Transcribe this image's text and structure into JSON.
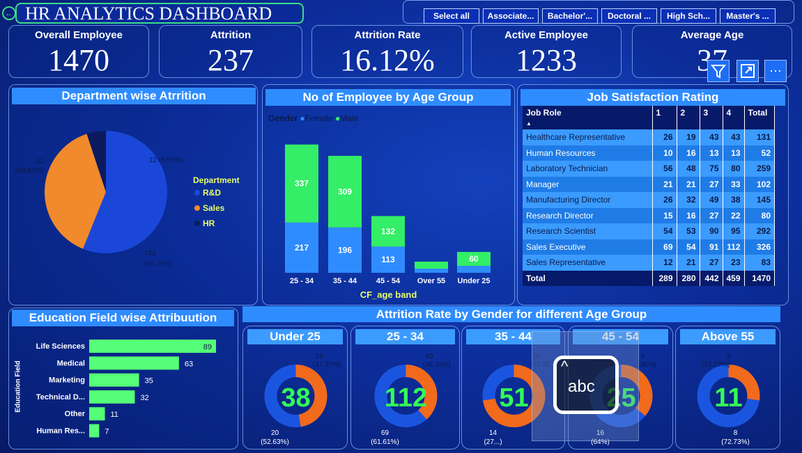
{
  "header": {
    "title": "HR ANALYTICS DASHBOARD",
    "back_glyph": "←"
  },
  "slicer": {
    "buttons": [
      "Select all",
      "Associate...",
      "Bachelor'...",
      "Doctoral ...",
      "High Sch...",
      "Master's ..."
    ]
  },
  "kpis": [
    {
      "label": "Overall Employee",
      "value": "1470"
    },
    {
      "label": "Attrition",
      "value": "237"
    },
    {
      "label": "Attrition Rate",
      "value": "16.12%"
    },
    {
      "label": "Active Employee",
      "value": "1233"
    },
    {
      "label": "Average Age",
      "value": "37"
    }
  ],
  "visual_menu": {
    "filter_icon": "filter-icon",
    "focus_icon": "focus-mode-icon",
    "more_icon": "more-options-icon",
    "more_glyph": "⋯"
  },
  "dept": {
    "title": "Department wise Atrrition",
    "legend_title": "Department",
    "labels": {
      "rd": "133",
      "rd_pct": "(56.12%)",
      "sales": "92",
      "sales_pct": "(38.82%)",
      "hr": "12 (5.06%)"
    },
    "colors": {
      "rd": "#1a47d8",
      "sales": "#f08a2c",
      "hr": "#0b1a5e"
    }
  },
  "age_group": {
    "title": "No of Employee by Age Group",
    "legend_label": "Gender",
    "female": "Female",
    "male": "Male",
    "xlabel": "CF_age band"
  },
  "job_sat": {
    "title": "Job Satisfaction Rating",
    "headers": [
      "Job Role",
      "1",
      "2",
      "3",
      "4",
      "Total"
    ],
    "rows": [
      [
        "Healthcare Representative",
        "26",
        "19",
        "43",
        "43",
        "131"
      ],
      [
        "Human Resources",
        "10",
        "16",
        "13",
        "13",
        "52"
      ],
      [
        "Laboratory Technician",
        "56",
        "48",
        "75",
        "80",
        "259"
      ],
      [
        "Manager",
        "21",
        "21",
        "27",
        "33",
        "102"
      ],
      [
        "Manufacturing Director",
        "26",
        "32",
        "49",
        "38",
        "145"
      ],
      [
        "Research Director",
        "15",
        "16",
        "27",
        "22",
        "80"
      ],
      [
        "Research Scientist",
        "54",
        "53",
        "90",
        "95",
        "292"
      ],
      [
        "Sales Executive",
        "69",
        "54",
        "91",
        "112",
        "326"
      ],
      [
        "Sales Representative",
        "12",
        "21",
        "27",
        "23",
        "83"
      ]
    ],
    "total": [
      "Total",
      "289",
      "280",
      "442",
      "459",
      "1470"
    ]
  },
  "edu": {
    "title": "Education Field wise Attribuution",
    "ylabel": "Education Field"
  },
  "gender_age": {
    "title": "Attrition Rate by Gender for different Age Group",
    "cards": [
      {
        "title": "Under 25",
        "center": "38",
        "top": "18",
        "top_pct": "(47.37%)",
        "bottom": "20",
        "bottom_pct": "(52.63%)"
      },
      {
        "title": "25 - 34",
        "center": "112",
        "top": "43",
        "top_pct": "(38.39%)",
        "bottom": "69",
        "bottom_pct": "(61.61%)"
      },
      {
        "title": "35 - 44",
        "center": "51",
        "top": "37",
        "top_pct": "(72.55...",
        "bottom": "14",
        "bottom_pct": "(27...)"
      },
      {
        "title": "45 - 54",
        "center": "25",
        "top": "9",
        "top_pct": "(36%)",
        "bottom": "16",
        "bottom_pct": "(64%)"
      },
      {
        "title": "Above 55",
        "center": "11",
        "top": "3",
        "top_pct": "(27.27%)",
        "bottom": "8",
        "bottom_pct": "(72.73%)"
      }
    ]
  },
  "keyboard_overlay": {
    "label": "abc"
  },
  "chart_data": [
    {
      "type": "pie",
      "title": "Department wise Atrrition",
      "legend": "Department",
      "categories": [
        "R&D",
        "Sales",
        "HR"
      ],
      "values": [
        133,
        92,
        12
      ],
      "percents": [
        56.12,
        38.82,
        5.06
      ],
      "legend_placement": "right"
    },
    {
      "type": "bar",
      "stacked": true,
      "title": "No of Employee by Age Group",
      "xlabel": "CF_age band",
      "legend": "Gender",
      "categories": [
        "25 - 34",
        "35 - 44",
        "45 - 54",
        "Over 55",
        "Under 25"
      ],
      "series": [
        {
          "name": "Female",
          "values": [
            217,
            196,
            113,
            18,
            30
          ],
          "color": "#2f8cff",
          "labels": [
            "217",
            "196",
            "113",
            "",
            ""
          ]
        },
        {
          "name": "Male",
          "values": [
            337,
            309,
            132,
            30,
            60
          ],
          "color": "#33ee66",
          "labels": [
            "337",
            "309",
            "132",
            "",
            "60"
          ]
        }
      ]
    },
    {
      "type": "bar",
      "orientation": "horizontal",
      "title": "Education Field wise Attribuution",
      "ylabel": "Education Field",
      "categories": [
        "Life Sciences",
        "Medical",
        "Marketing",
        "Technical D...",
        "Other",
        "Human Res..."
      ],
      "values": [
        89,
        63,
        35,
        32,
        11,
        7
      ],
      "color": "#55ff77"
    }
  ]
}
